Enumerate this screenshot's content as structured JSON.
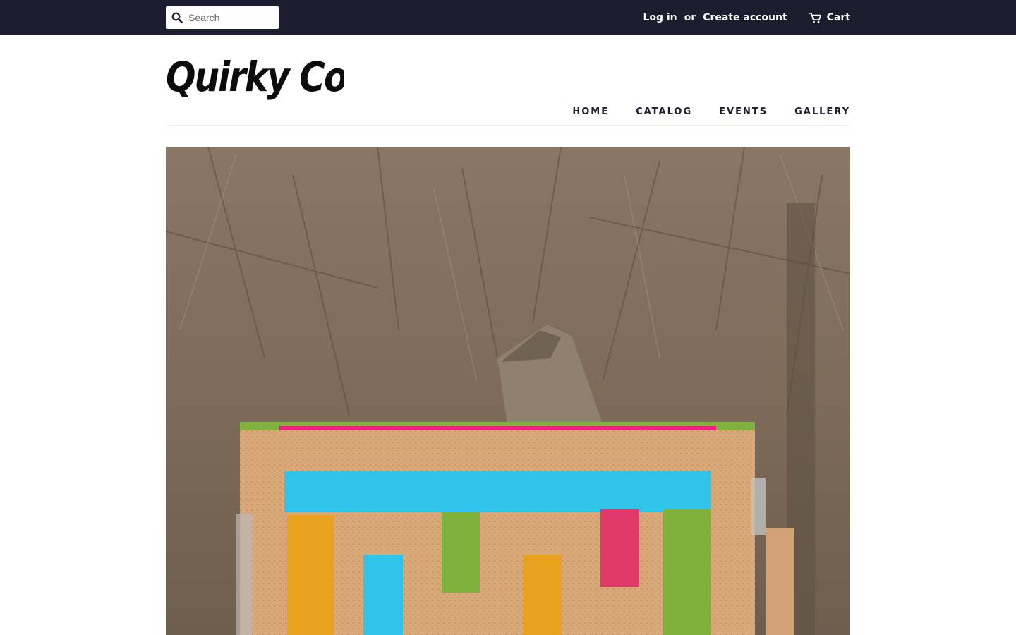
{
  "topbar": {
    "search": {
      "placeholder": "Search",
      "icon": "search-icon"
    },
    "login_label": "Log in",
    "or_label": "or",
    "create_account_label": "Create account",
    "cart_label": "Cart",
    "cart_icon": "cart-icon"
  },
  "header": {
    "logo_text": "Quirky Cork",
    "nav": [
      {
        "label": "HOME"
      },
      {
        "label": "CATALOG"
      },
      {
        "label": "EVENTS"
      },
      {
        "label": "GALLERY"
      }
    ]
  },
  "colors": {
    "topbar_bg": "#1c1d2e",
    "text": "#1c1d2e",
    "cork": "#d9a97a",
    "stripe_blue": "#2fc4ea",
    "stripe_yellow": "#e8a21e",
    "stripe_green": "#7fb13c",
    "stripe_pink": "#df3a6a",
    "zipper_pink": "#f0207f"
  }
}
